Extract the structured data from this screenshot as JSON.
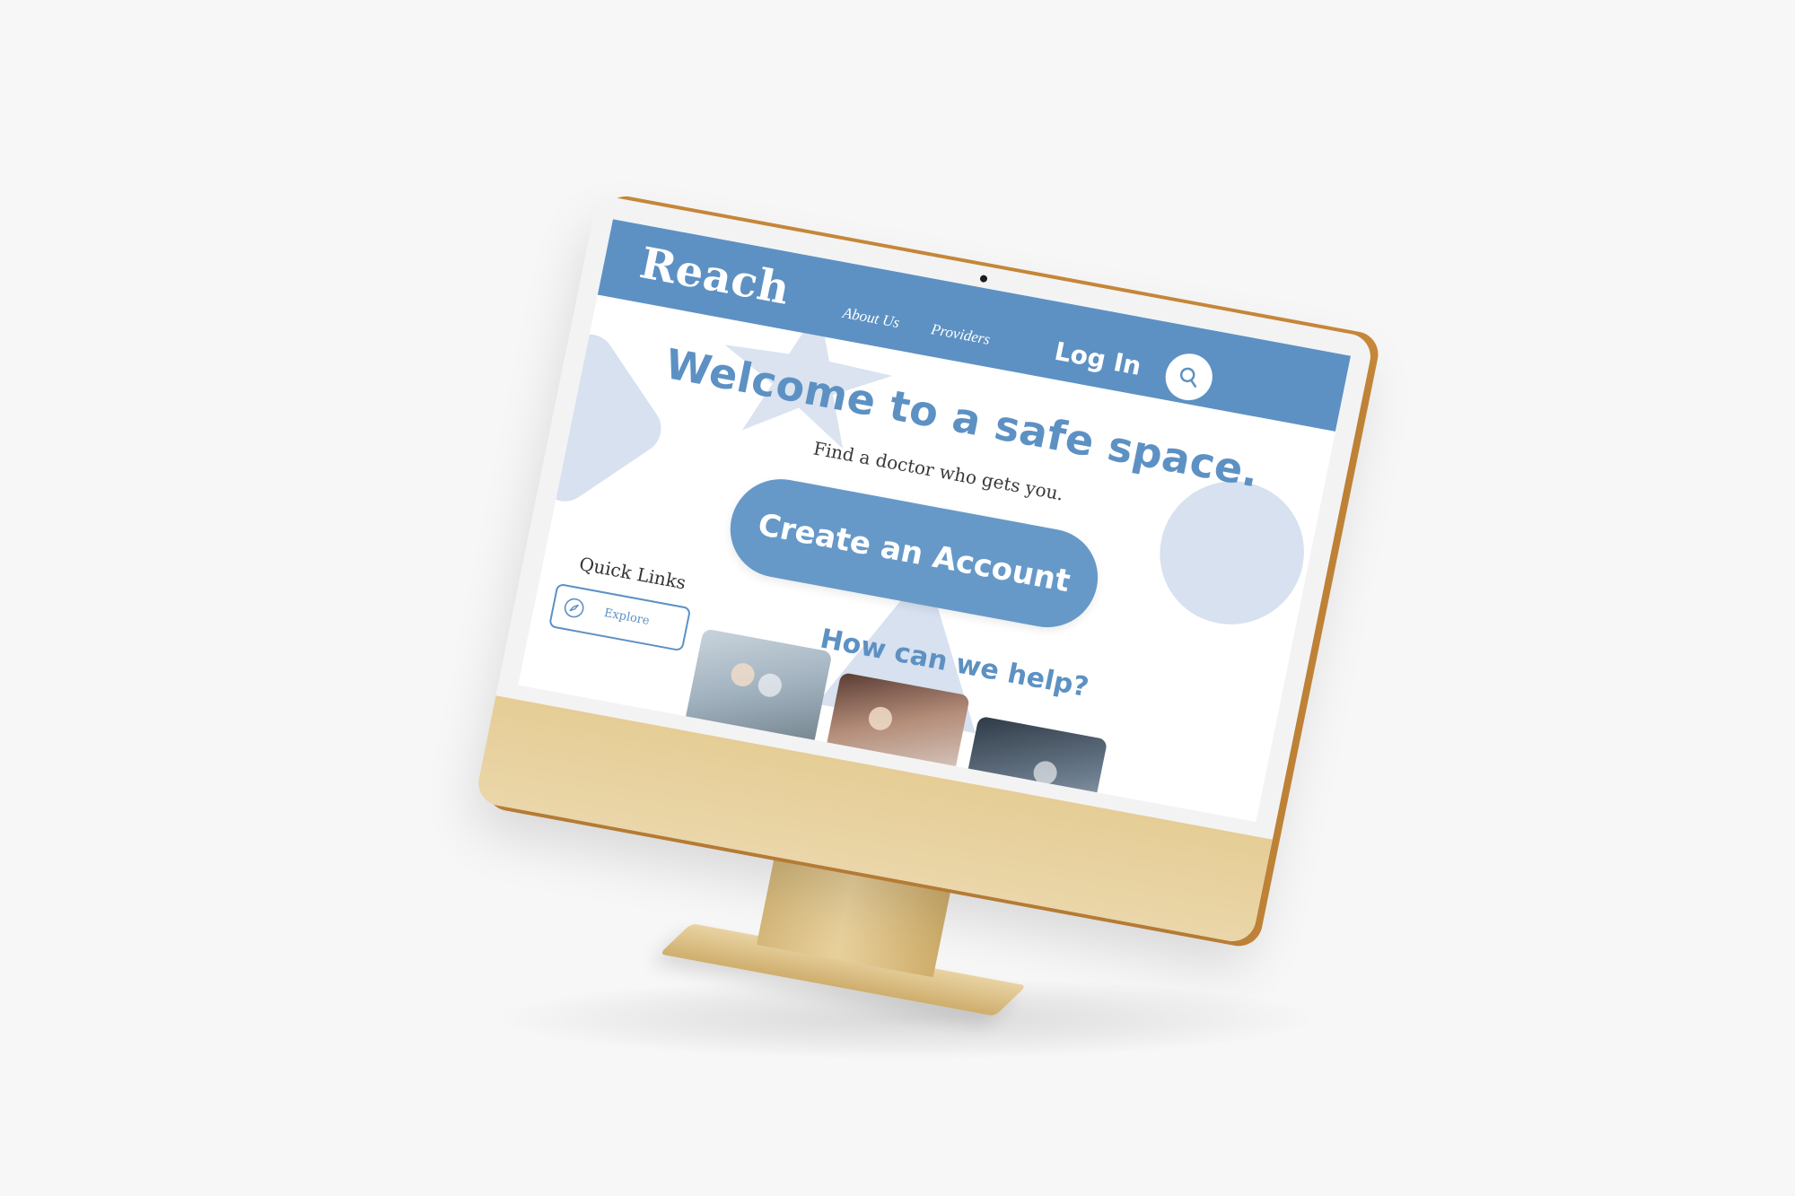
{
  "site": {
    "logo": "Reach",
    "nav": {
      "about": "About Us",
      "providers": "Providers",
      "login": "Log In"
    },
    "hero": {
      "title": "Welcome to a safe space.",
      "subtitle": "Find a doctor who gets you.",
      "cta": "Create an Account"
    },
    "quick_links": {
      "title": "Quick Links",
      "items": [
        {
          "label": "Explore",
          "icon": "compass-icon"
        }
      ]
    },
    "help": {
      "title": "How can we help?"
    }
  },
  "colors": {
    "brand_blue": "#5d91c3",
    "button_blue": "#6699c8",
    "shape_tint": "#d7e1ef",
    "device_gold": "#e6cd96"
  }
}
